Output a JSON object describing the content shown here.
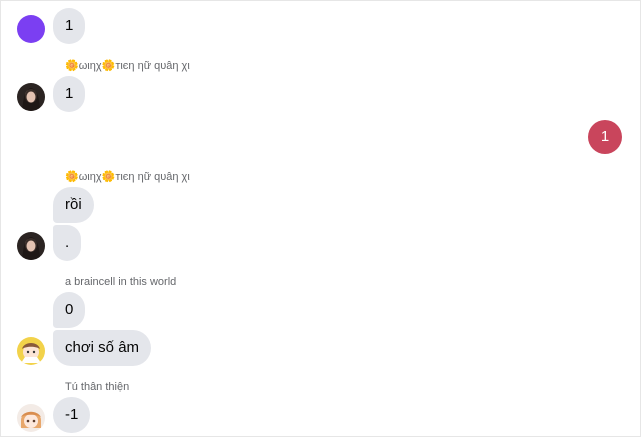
{
  "messages": [
    {
      "text": "1"
    },
    {
      "sender": "🌼ωιηχ🌼тιєη ηữ qυâη χι",
      "text": "1"
    },
    {
      "text": "1",
      "outgoing": true
    },
    {
      "sender": "🌼ωιηχ🌼тιєη ηữ qυâη χι",
      "text": "rồi",
      "text2": "."
    },
    {
      "sender": "a braincell in this world",
      "text": "0",
      "text2": "chơi số âm"
    },
    {
      "sender": "Tú thân thiện",
      "text": "-1"
    }
  ],
  "colors": {
    "incoming_bubble": "#e4e6eb",
    "outgoing_bubble": "#c9455c",
    "first_avatar": "#7b3ff2"
  }
}
